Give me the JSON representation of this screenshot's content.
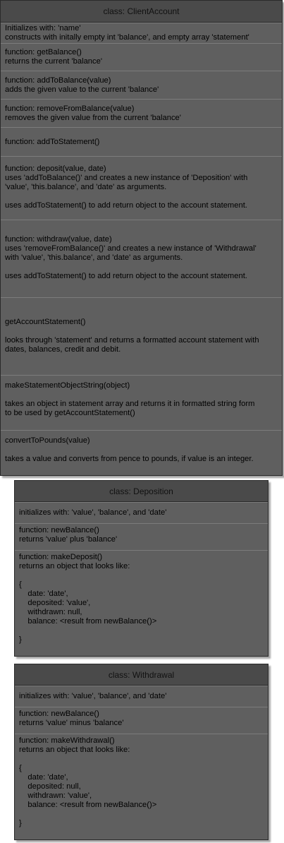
{
  "classes": [
    {
      "title": "class: ClientAccount",
      "sections": [
        [
          "Initializes with: 'name'",
          "constructs with initally empty int 'balance', and empty array 'statement'"
        ],
        [
          "function: getBalance()",
          "returns the current 'balance'"
        ],
        [
          "function: addToBalance(value)",
          "adds the given value to the current 'balance'"
        ],
        [
          "function: removeFromBalance(value)",
          "removes the given value from the current 'balance'"
        ],
        [
          "function: addToStatement()"
        ],
        [
          "function: deposit(value, date)",
          "uses 'addToBalance()' and creates a new instance of 'Deposition' with",
          "'value', 'this.balance', and 'date' as arguments.",
          "",
          "uses addToStatement() to add return object to the account statement."
        ],
        [
          "function: withdraw(value, date)",
          "uses 'removeFromBalance()' and creates a new instance of 'Withdrawal'",
          "with 'value', 'this.balance', and 'date' as arguments.",
          "",
          "uses addToStatement() to add return object to the account statement."
        ],
        [
          "getAccountStatement()",
          "",
          "looks through 'statement' and returns a formatted account statement with",
          "dates, balances, credit and debit."
        ],
        [
          "makeStatementObjectString(object)",
          "",
          "takes an object in statement array and returns it in formatted string form",
          "to be used by getAccountStatement()"
        ],
        [
          "convertToPounds(value)",
          "",
          "takes a value and converts from pence to pounds, if value is an integer."
        ]
      ]
    },
    {
      "title": "class: Deposition",
      "sections": [
        [
          "initializes with: 'value', 'balance', and 'date'"
        ],
        [
          "function: newBalance()",
          "returns 'value' plus 'balance'"
        ],
        [
          "function: makeDeposit()",
          "returns an object that looks like:",
          "",
          "{",
          "    date: 'date',",
          "    deposited: 'value',",
          "    withdrawn: null,",
          "    balance: <result from newBalance()>",
          "",
          "}"
        ]
      ]
    },
    {
      "title": "class: Withdrawal",
      "sections": [
        [
          "initializes with: 'value', 'balance', and 'date'"
        ],
        [
          "function: newBalance()",
          "returns 'value' minus 'balance'"
        ],
        [
          "function: makeWithdrawal()",
          "returns an object that looks like:",
          "",
          "{",
          "    date: 'date',",
          "    deposited: null,",
          "    withdrawn: 'value',",
          "    balance: <result from newBalance()>",
          "",
          "}"
        ]
      ]
    }
  ]
}
